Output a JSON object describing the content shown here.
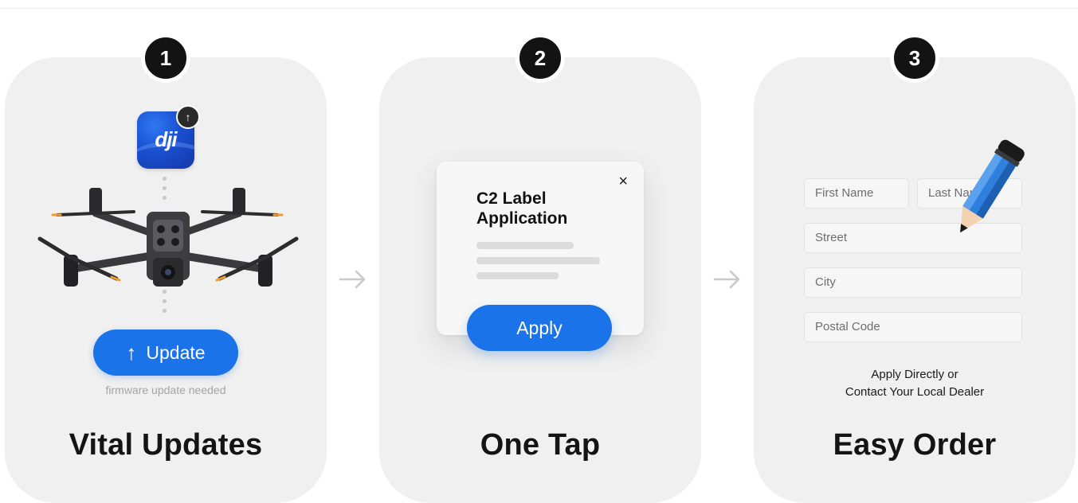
{
  "steps": [
    {
      "number": "1",
      "title": "Vital Updates"
    },
    {
      "number": "2",
      "title": "One Tap"
    },
    {
      "number": "3",
      "title": "Easy Order"
    }
  ],
  "step1": {
    "app_logo": "dji",
    "update_button_label": "Update",
    "update_note": "firmware update needed",
    "arrow_up_glyph": "↑"
  },
  "step2": {
    "dialog_title": "C2 Label Application",
    "close_glyph": "×",
    "apply_button_label": "Apply"
  },
  "step3": {
    "fields": {
      "first_name": "First Name",
      "last_name": "Last Name",
      "street": "Street",
      "city": "City",
      "postal_code": "Postal Code"
    },
    "footnote_line1": "Apply Directly or",
    "footnote_line2": "Contact Your Local Dealer"
  },
  "colors": {
    "accent_blue": "#1a73e8",
    "card_bg": "#f0f0f0",
    "badge_bg": "#131313",
    "title_text": "#141414"
  },
  "icons": [
    "upload-arrow-icon",
    "dji-app-icon",
    "drone-icon",
    "close-icon",
    "pencil-icon",
    "right-arrow-icon"
  ]
}
